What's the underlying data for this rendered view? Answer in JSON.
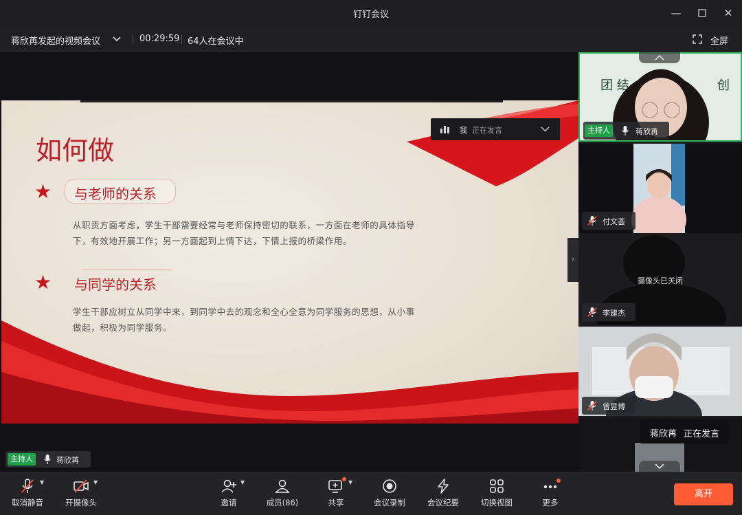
{
  "window": {
    "title": "钉钉会议"
  },
  "info": {
    "meeting_name": "蒋欣苒发起的视频会议",
    "elapsed": "00:29:59",
    "participants": "64人在会议中",
    "fullscreen": "全屏"
  },
  "slide": {
    "title": "如何做",
    "section1_heading": "与老师的关系",
    "section1_line1": "从职责方面考虑，学生干部需要经常与老师保持密切的联系，一方面在老师的具体指导",
    "section1_line2": "下，有效地开展工作；另一方面起到上情下达，下情上报的桥梁作用。",
    "section2_heading": "与同学的关系",
    "section2_line1": "学生干部应树立从同学中来，到同学中去的观念和全心全意为同学服务的思想，从小事",
    "section2_line2": "做起，积极为同学服务。"
  },
  "speaking_popup": {
    "me": "我",
    "status": "正在发言"
  },
  "host_label": {
    "tag": "主持人",
    "name": "蒋欣苒"
  },
  "participants": [
    {
      "name": "蒋欣苒",
      "host_tag": "主持人"
    },
    {
      "name": "付文荟"
    },
    {
      "name": "李建杰",
      "camera_status": "摄像头已关闭"
    },
    {
      "name": "曾昱博"
    }
  ],
  "speaker_tip": {
    "name": "蒋欣苒",
    "status": "正在发言"
  },
  "toolbar": {
    "mute": "取消静音",
    "camera": "开摄像头",
    "invite": "邀请",
    "members": "成员(86)",
    "share": "共享",
    "record": "会议录制",
    "minutes": "会议纪要",
    "switch_view": "切换视图",
    "more": "更多",
    "leave": "离开"
  },
  "colors": {
    "host_green": "#21a04a",
    "leave_orange": "#ff5b35",
    "slide_red": "#b8222a"
  }
}
